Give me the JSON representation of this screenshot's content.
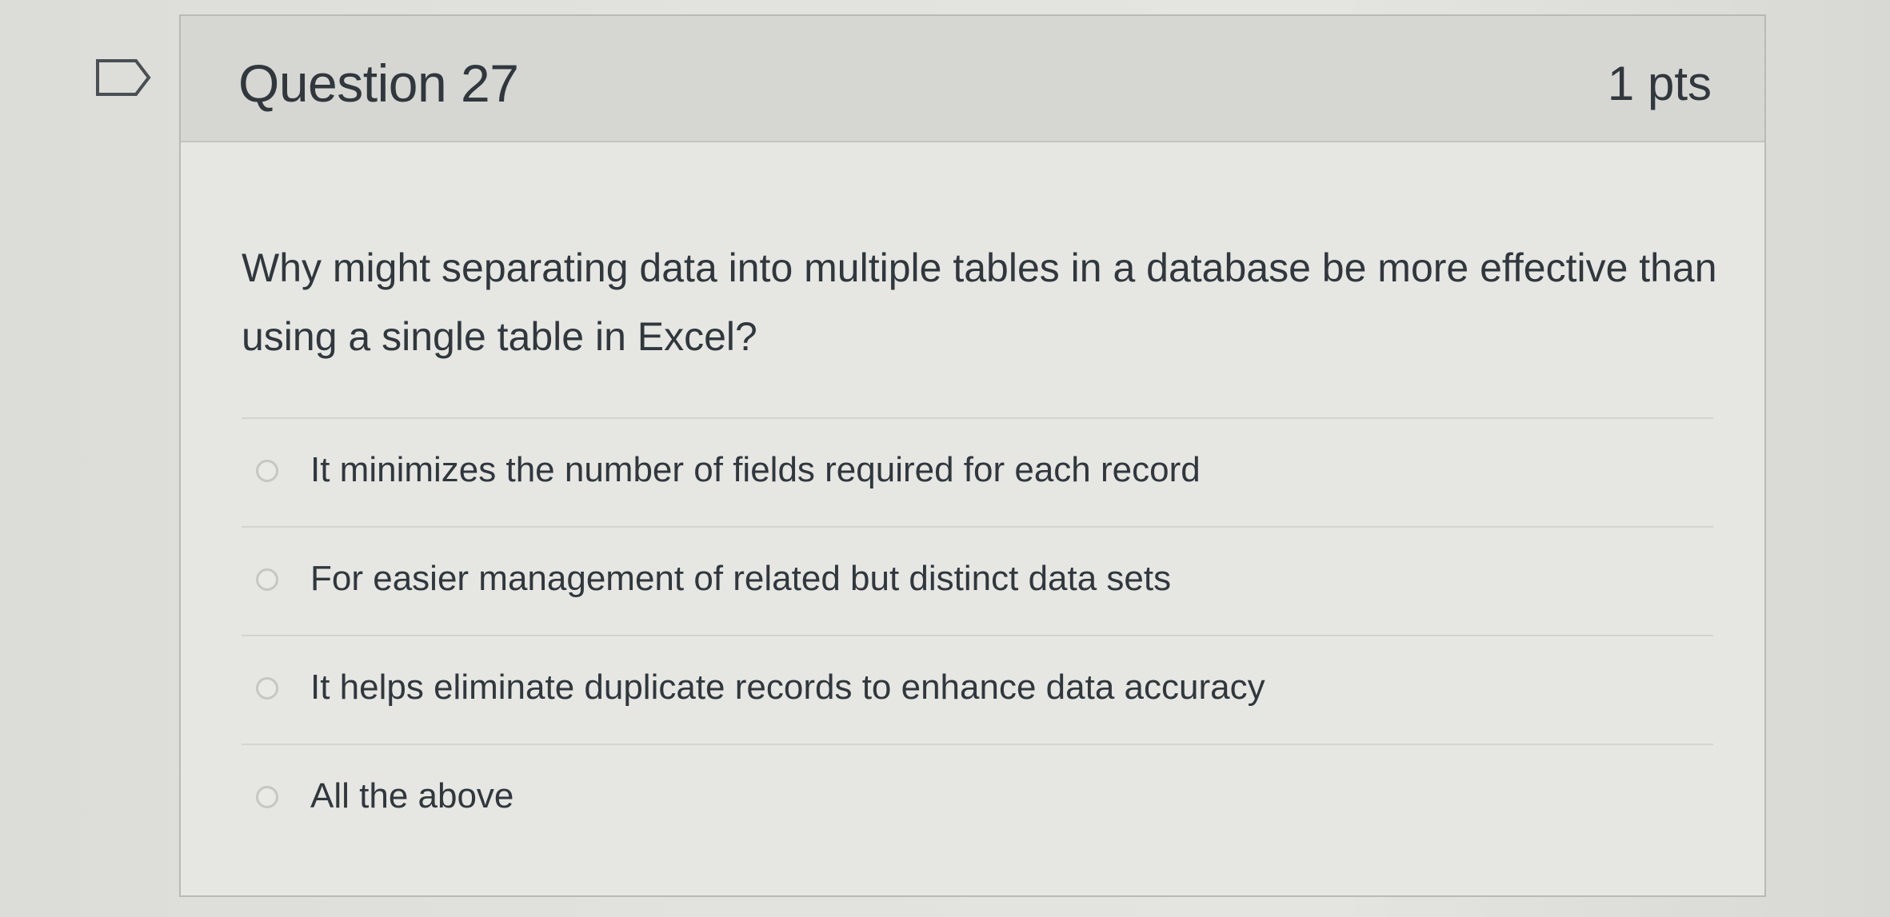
{
  "question": {
    "title": "Question 27",
    "points": "1 pts",
    "text": "Why might separating data into multiple tables in a database be more effective than using a single table in Excel?",
    "flag_icon": "flag-outline-icon",
    "answers": [
      {
        "label": "It minimizes the number of fields required for each record"
      },
      {
        "label": "For easier management of related but distinct data sets"
      },
      {
        "label": "It helps eliminate duplicate records to enhance data accuracy"
      },
      {
        "label": "All the above"
      }
    ]
  }
}
